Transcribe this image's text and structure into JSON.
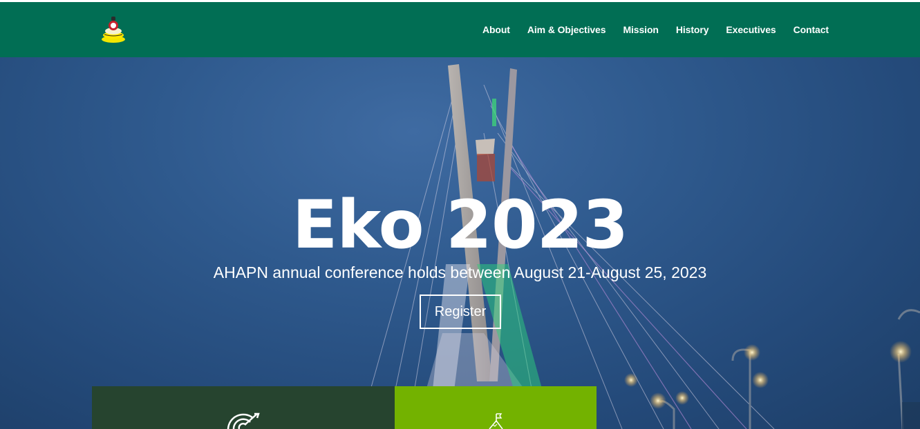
{
  "brand": {
    "logo_icon": "ahapn-logo-icon"
  },
  "nav": {
    "items": [
      {
        "label": "About"
      },
      {
        "label": "Aim & Objectives"
      },
      {
        "label": "Mission"
      },
      {
        "label": "History"
      },
      {
        "label": "Executives"
      },
      {
        "label": "Contact"
      }
    ]
  },
  "hero": {
    "title": "Eko 2023",
    "subtitle": "AHAPN annual conference holds between August 21-August 25, 2023",
    "register_label": "Register"
  },
  "cards": [
    {
      "icon": "target-icon",
      "color": "#26442f"
    },
    {
      "icon": "flag-summit-icon",
      "color": "#73b200"
    }
  ],
  "colors": {
    "nav_bg": "#016e54",
    "card_dark": "#26442f",
    "card_green": "#73b200"
  }
}
